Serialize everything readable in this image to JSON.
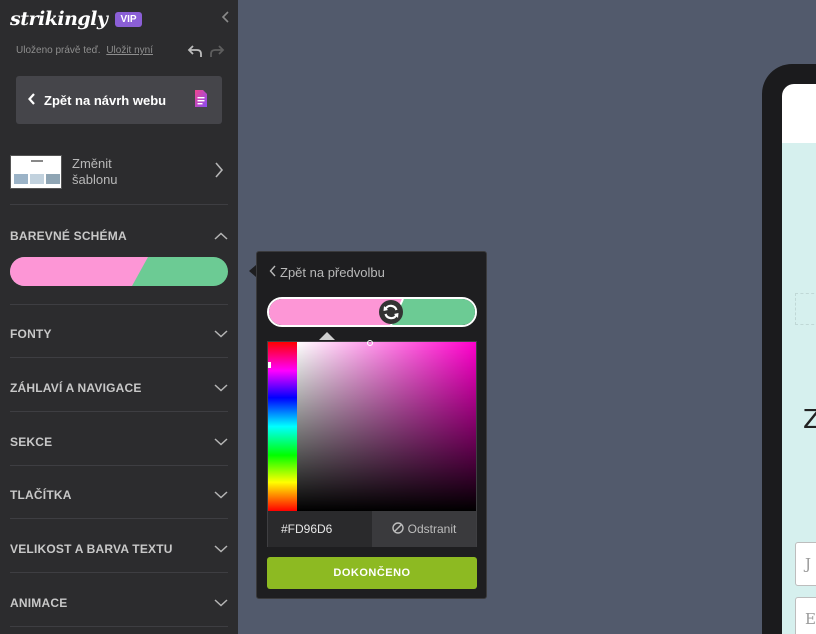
{
  "brand": {
    "logo": "strikingly",
    "badge": "VIP"
  },
  "save_status": {
    "text": "Uloženo právě teď.",
    "link": "Uložit nyní"
  },
  "back_button": {
    "label": "Zpět na návrh webu"
  },
  "template": {
    "label": "Změnit šablonu"
  },
  "sections": [
    {
      "label": "BAREVNÉ SCHÉMA",
      "expanded": true
    },
    {
      "label": "FONTY",
      "expanded": false
    },
    {
      "label": "ZÁHLAVÍ A NAVIGACE",
      "expanded": false
    },
    {
      "label": "SEKCE",
      "expanded": false
    },
    {
      "label": "TLAČÍTKA",
      "expanded": false
    },
    {
      "label": "VELIKOST A BARVA TEXTU",
      "expanded": false
    },
    {
      "label": "ANIMACE",
      "expanded": false
    }
  ],
  "color_scheme": {
    "primary": "#FD96D6",
    "secondary": "#6CCB94"
  },
  "color_popover": {
    "back_label": "Zpět na předvolbu",
    "hex_value": "#FD96D6",
    "remove_label": "Odstranit",
    "done_label": "DOKONČENO"
  },
  "preview": {
    "heading_char": "Z",
    "field1_char": "J",
    "field2_char": "E"
  },
  "colors": {
    "sidebar_bg": "#2c2c2e",
    "canvas_bg": "#525a6c",
    "accent_vip": "#8b5fd6",
    "done_button": "#8dba22"
  }
}
